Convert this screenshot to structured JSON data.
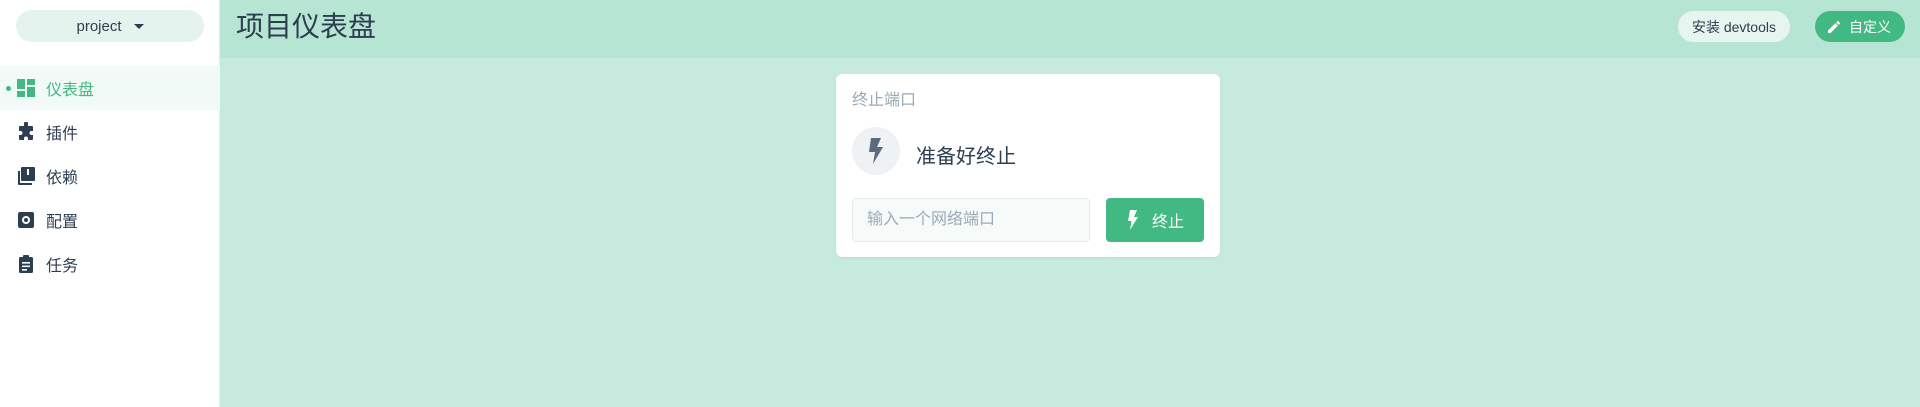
{
  "sidebar": {
    "project_select": {
      "label": "project",
      "icon": "caret-down-icon"
    },
    "items": [
      {
        "label": "仪表盘",
        "icon": "dashboard-icon",
        "active": true
      },
      {
        "label": "插件",
        "icon": "puzzle-icon",
        "active": false
      },
      {
        "label": "依赖",
        "icon": "library-icon",
        "active": false
      },
      {
        "label": "配置",
        "icon": "settings-icon",
        "active": false
      },
      {
        "label": "任务",
        "icon": "clipboard-icon",
        "active": false
      }
    ]
  },
  "header": {
    "title": "项目仪表盘",
    "devtools_label": "安装 devtools",
    "customize_label": "自定义",
    "customize_icon": "pencil-icon"
  },
  "kill_port": {
    "title": "终止端口",
    "status_icon": "lightning-icon",
    "status_text": "准备好终止",
    "input_value": "",
    "input_placeholder": "输入一个网络端口",
    "kill_label": "终止",
    "kill_icon": "lightning-icon"
  },
  "colors": {
    "accent": "#42b983",
    "header_bg": "#b7e5d3",
    "main_bg": "#c6eadd",
    "text": "#2c3e50"
  }
}
